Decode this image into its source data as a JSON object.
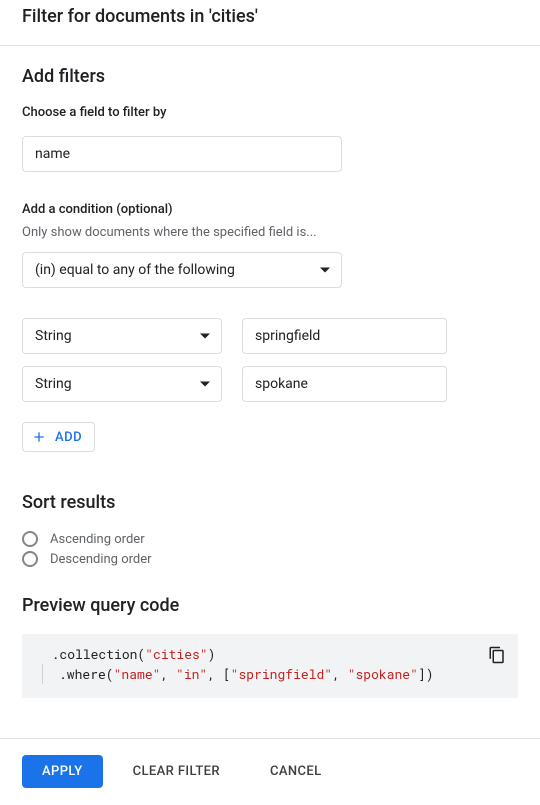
{
  "header": {
    "title": "Filter for documents in 'cities'"
  },
  "filters": {
    "section_title": "Add filters",
    "field_label": "Choose a field to filter by",
    "field_value": "name",
    "condition_label": "Add a condition (optional)",
    "condition_helper": "Only show documents where the specified field is...",
    "condition_operator": "(in) equal to any of the following",
    "values": [
      {
        "type": "String",
        "value": "springfield"
      },
      {
        "type": "String",
        "value": "spokane"
      }
    ],
    "add_button": "ADD"
  },
  "sort": {
    "section_title": "Sort results",
    "options": [
      {
        "label": "Ascending order",
        "selected": false
      },
      {
        "label": "Descending order",
        "selected": false
      }
    ]
  },
  "preview": {
    "section_title": "Preview query code",
    "code_tokens": {
      "prefix1": "  .collection(",
      "coll": "\"cities\"",
      "suffix1": ")",
      "prefix2": ".where(",
      "field": "\"name\"",
      "sep1": ", ",
      "op": "\"in\"",
      "sep2": ", [",
      "v1": "\"springfield\"",
      "sep3": ", ",
      "v2": "\"spokane\"",
      "suffix2": "])"
    }
  },
  "footer": {
    "apply": "APPLY",
    "clear": "CLEAR FILTER",
    "cancel": "CANCEL"
  }
}
